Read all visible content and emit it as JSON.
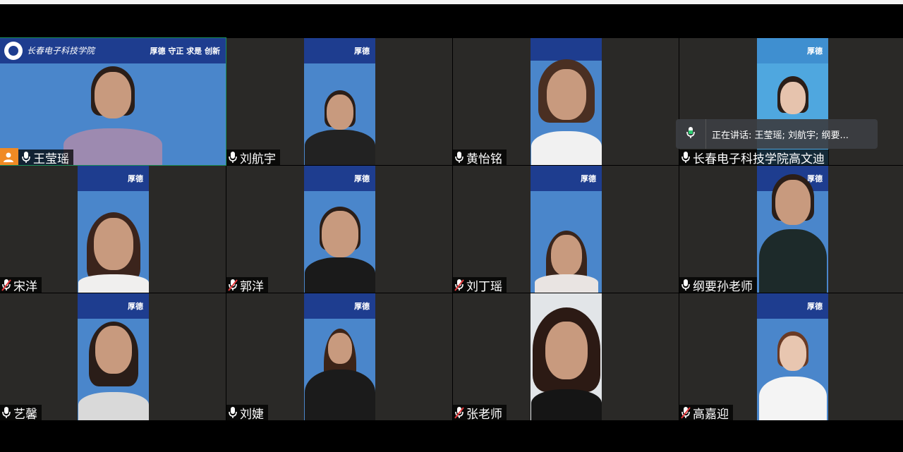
{
  "school_banner": {
    "name": "长春电子科技学院",
    "motto": "厚德 守正 求是 创新",
    "motto_short": "厚德"
  },
  "speaking_indicator": {
    "text": "正在讲话: 王莹瑶; 刘航宇; 纲要..."
  },
  "participants": [
    {
      "name": "王莹瑶",
      "mic": "on",
      "host": true
    },
    {
      "name": "刘航宇",
      "mic": "on"
    },
    {
      "name": "黄怡铭",
      "mic": "on"
    },
    {
      "name": "长春电子科技学院高文迪",
      "mic": "on"
    },
    {
      "name": "宋洋",
      "mic": "muted"
    },
    {
      "name": "郭洋",
      "mic": "muted"
    },
    {
      "name": "刘丁瑶",
      "mic": "muted"
    },
    {
      "name": "纲要孙老师",
      "mic": "on"
    },
    {
      "name": "艺馨",
      "mic": "on"
    },
    {
      "name": "刘婕",
      "mic": "on"
    },
    {
      "name": "张老师",
      "mic": "muted"
    },
    {
      "name": "高嘉迎",
      "mic": "muted"
    }
  ],
  "colors": {
    "tile_bg": "#2a2927",
    "video_blue": "#4a86cb",
    "banner_blue": "#1e3d8f",
    "host_badge": "#f08a24",
    "active_outline": "#1a8f5a"
  }
}
